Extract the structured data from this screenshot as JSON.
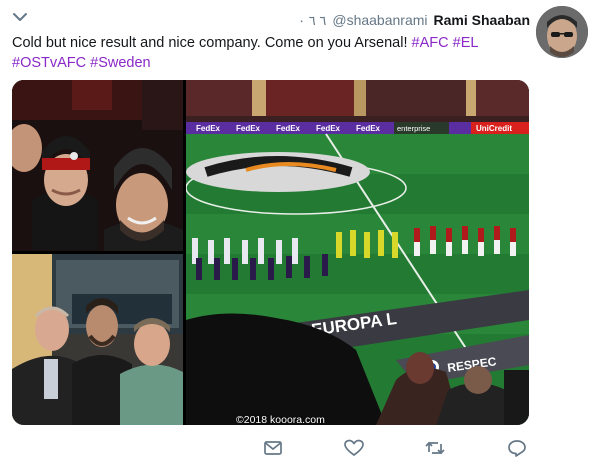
{
  "header": {
    "verified_text": "٦ ٦ ٠",
    "handle": "@shaabanrami",
    "display_name": "Rami Shaaban"
  },
  "tweet": {
    "text_plain": "Cold but nice result and nice company. Come on you Arsenal! ",
    "hashtags": [
      "#AFC",
      "#EL",
      "#OSTvAFC",
      "#Sweden"
    ]
  },
  "media": {
    "watermark": "©2018 kooora.com",
    "photo_c_text": {
      "banner_top": "FedEx",
      "europa": "A EUROPA L",
      "respect": "RESPEC",
      "unicredit": "UniCredit",
      "enterprise": "enterprise"
    }
  },
  "icons": {
    "menu": "chevron-down-icon",
    "reply": "reply-icon",
    "retweet": "retweet-icon",
    "like": "heart-icon",
    "share": "share-icon",
    "direct": "envelope-icon"
  },
  "colors": {
    "hashtag": "#8a28c8",
    "icon": "#657786",
    "text": "#14171a"
  }
}
